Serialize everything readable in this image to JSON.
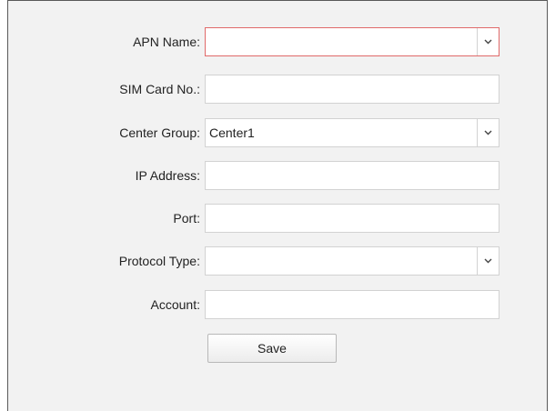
{
  "form": {
    "apn_name": {
      "label": "APN Name:",
      "value": ""
    },
    "sim_card_no": {
      "label": "SIM Card No.:",
      "value": ""
    },
    "center_group": {
      "label": "Center Group:",
      "value": "Center1"
    },
    "ip_address": {
      "label": "IP Address:",
      "value": ""
    },
    "port": {
      "label": "Port:",
      "value": ""
    },
    "protocol_type": {
      "label": "Protocol Type:",
      "value": ""
    },
    "account": {
      "label": "Account:",
      "value": ""
    },
    "save_label": "Save"
  },
  "icons": {
    "dropdown": "chevron-down-icon"
  },
  "colors": {
    "panel_background": "#f2f2f2",
    "active_field_border": "#e06a6a",
    "field_border": "#d2d2d2"
  }
}
